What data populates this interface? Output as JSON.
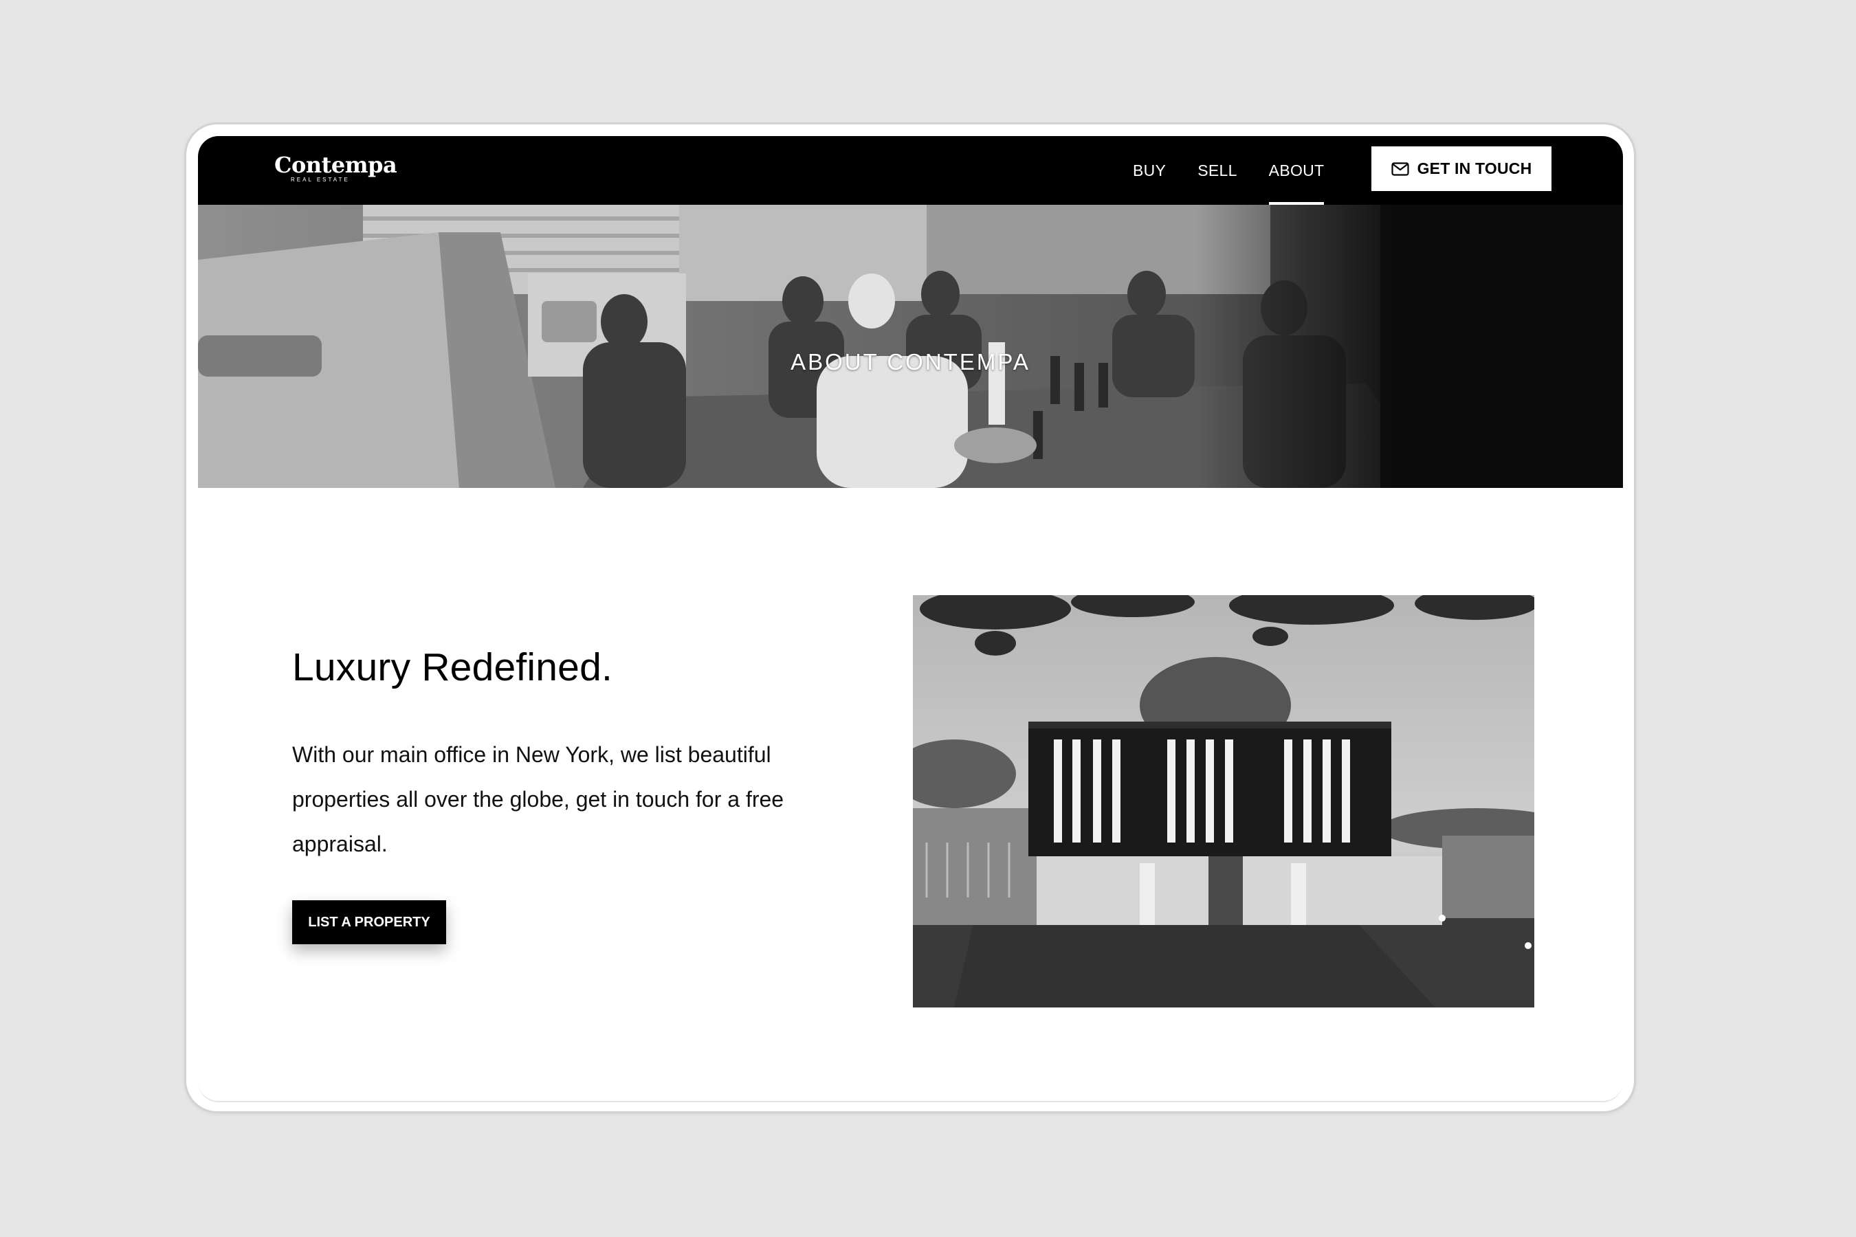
{
  "brand": {
    "name": "Contempa",
    "tagline": "REAL ESTATE"
  },
  "nav": {
    "items": [
      {
        "label": "BUY",
        "active": false
      },
      {
        "label": "SELL",
        "active": false
      },
      {
        "label": "ABOUT",
        "active": true
      }
    ],
    "cta": {
      "label": "GET IN TOUCH",
      "icon": "mail-icon"
    }
  },
  "hero": {
    "title": "ABOUT CONTEMPA"
  },
  "about": {
    "heading": "Luxury Redefined.",
    "body": "With our main office in New York, we list beautiful properties all over the globe, get in touch for a free appraisal.",
    "button_label": "LIST A PROPERTY"
  },
  "colors": {
    "background": "#e6e6e6",
    "nav": "#000000",
    "accent": "#ffffff"
  }
}
